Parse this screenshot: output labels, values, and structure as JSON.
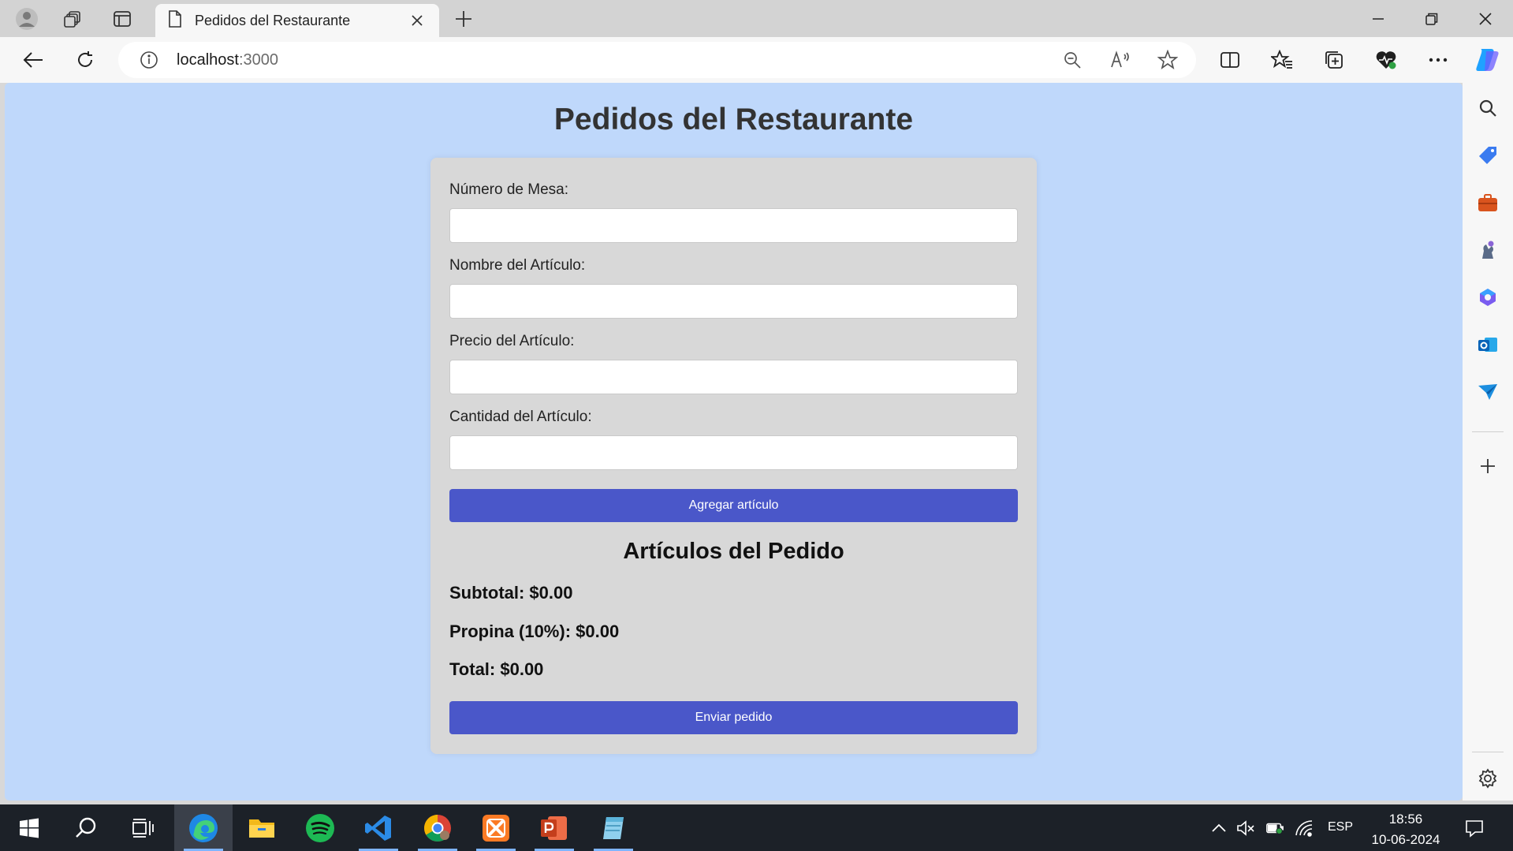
{
  "browser": {
    "tab_title": "Pedidos del Restaurante",
    "url_host": "localhost",
    "url_port": ":3000"
  },
  "page": {
    "title": "Pedidos del Restaurante",
    "form": {
      "table_label": "Número de Mesa:",
      "table_value": "",
      "item_name_label": "Nombre del Artículo:",
      "item_name_value": "",
      "item_price_label": "Precio del Artículo:",
      "item_price_value": "",
      "item_qty_label": "Cantidad del Artículo:",
      "item_qty_value": "",
      "add_button": "Agregar artículo"
    },
    "order": {
      "title": "Artículos del Pedido",
      "subtotal": "Subtotal: $0.00",
      "tip": "Propina (10%): $0.00",
      "total": "Total: $0.00",
      "submit_button": "Enviar pedido"
    }
  },
  "taskbar": {
    "language": "ESP",
    "time": "18:56",
    "date": "10-06-2024"
  },
  "colors": {
    "page_background": "#bfd8fb",
    "card_background": "#d8d8d8",
    "button": "#4a57c9"
  }
}
